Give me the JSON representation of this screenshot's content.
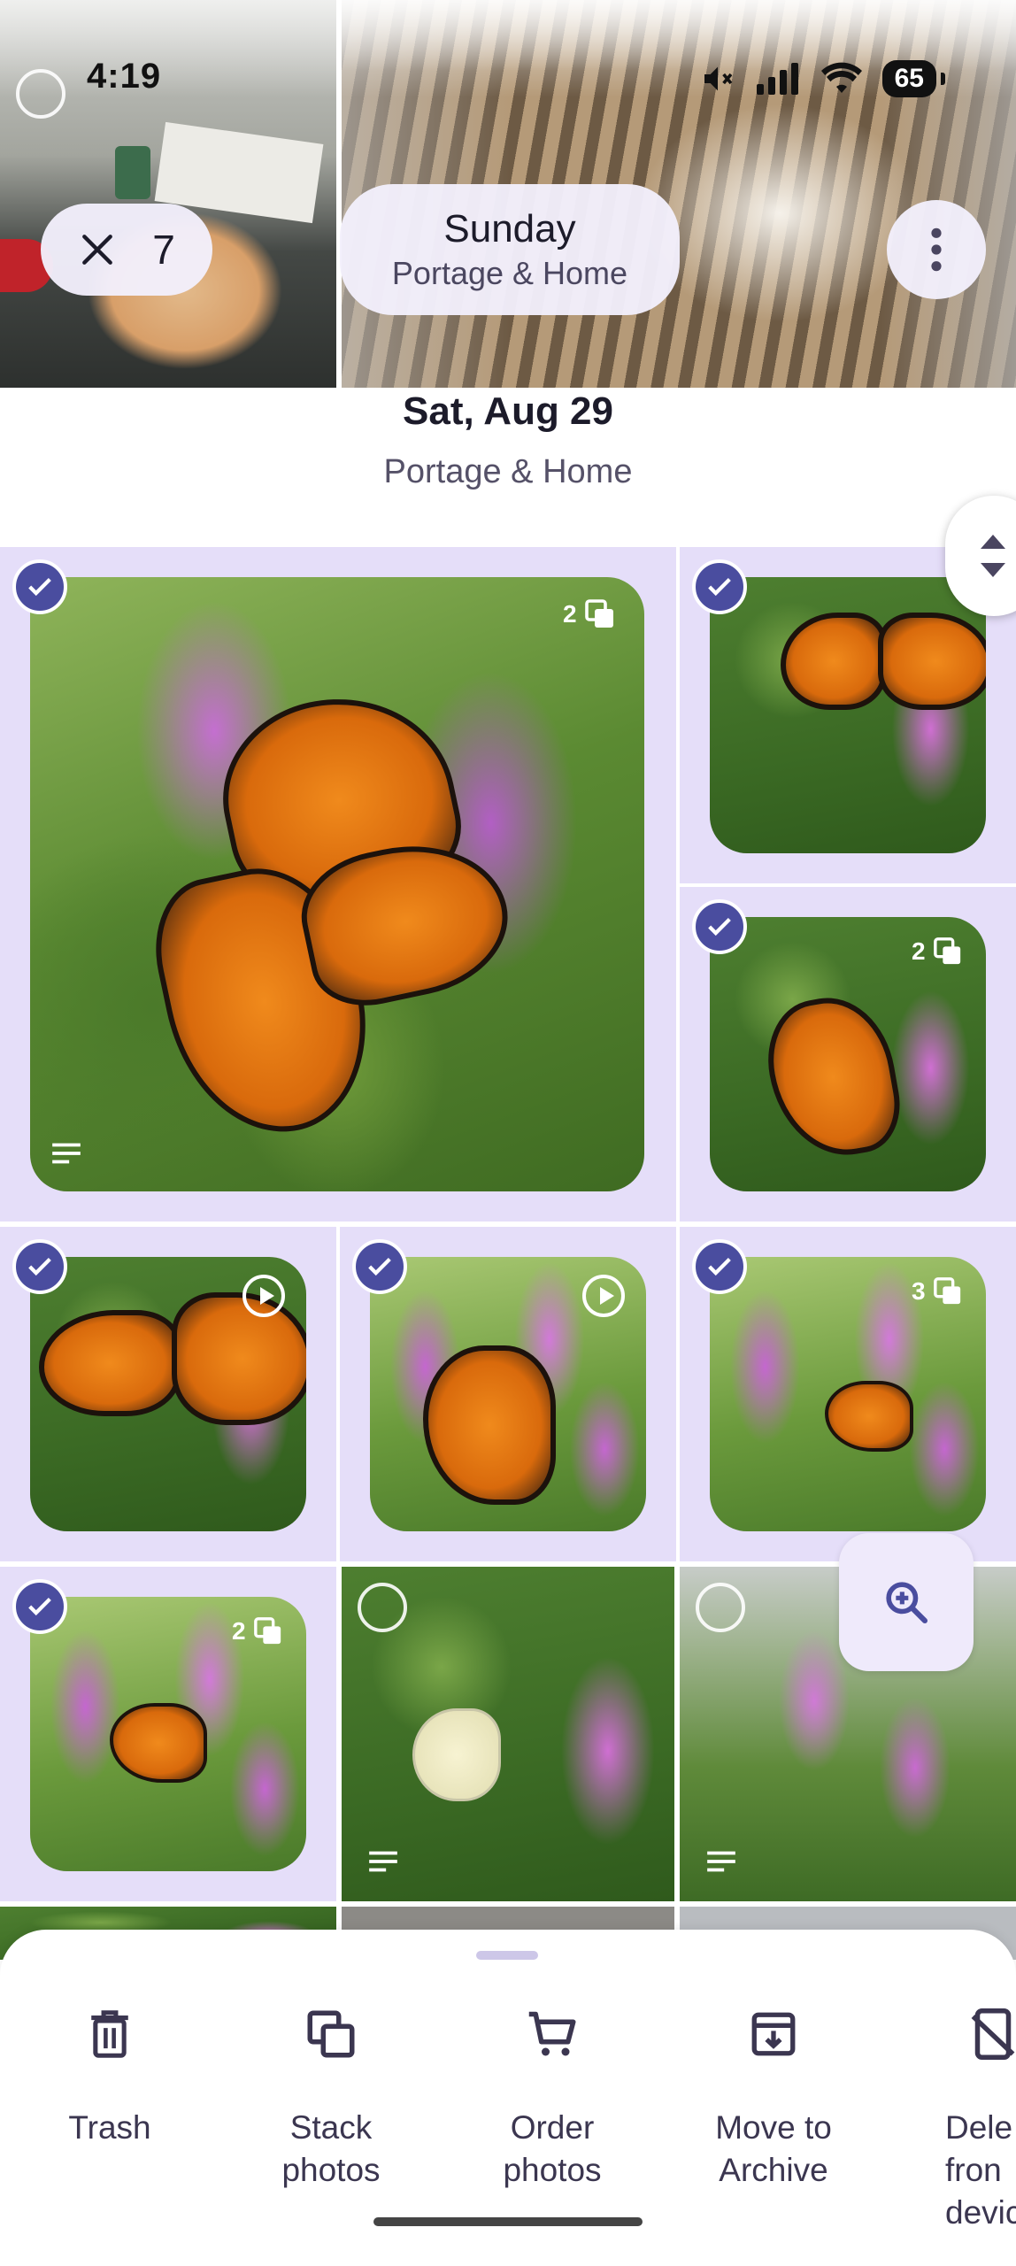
{
  "status_bar": {
    "time": "4:19",
    "battery": "65",
    "icons": [
      "mute-icon",
      "signal-icon",
      "wifi-icon",
      "battery-icon"
    ]
  },
  "header": {
    "selected_count": "7",
    "day_title": "Sunday",
    "day_subtitle": "Portage & Home"
  },
  "date_section": {
    "title": "Sat, Aug 29",
    "subtitle": "Portage & Home"
  },
  "grid": {
    "badges": {
      "large_stack": "2",
      "right_stack": "2",
      "row3_stack": "3",
      "row4_stack": "2"
    }
  },
  "actions": {
    "trash": "Trash",
    "stack_line1": "Stack",
    "stack_line2": "photos",
    "order_line1": "Order",
    "order_line2": "photos",
    "archive_line1": "Move to",
    "archive_line2": "Archive",
    "delete_line1": "Dele",
    "delete_line2": "fron",
    "delete_line3": "devic"
  },
  "colors": {
    "selection_bg": "#e5def9",
    "check_fill": "#4a4d9f",
    "pill_bg": "#f3effc"
  }
}
